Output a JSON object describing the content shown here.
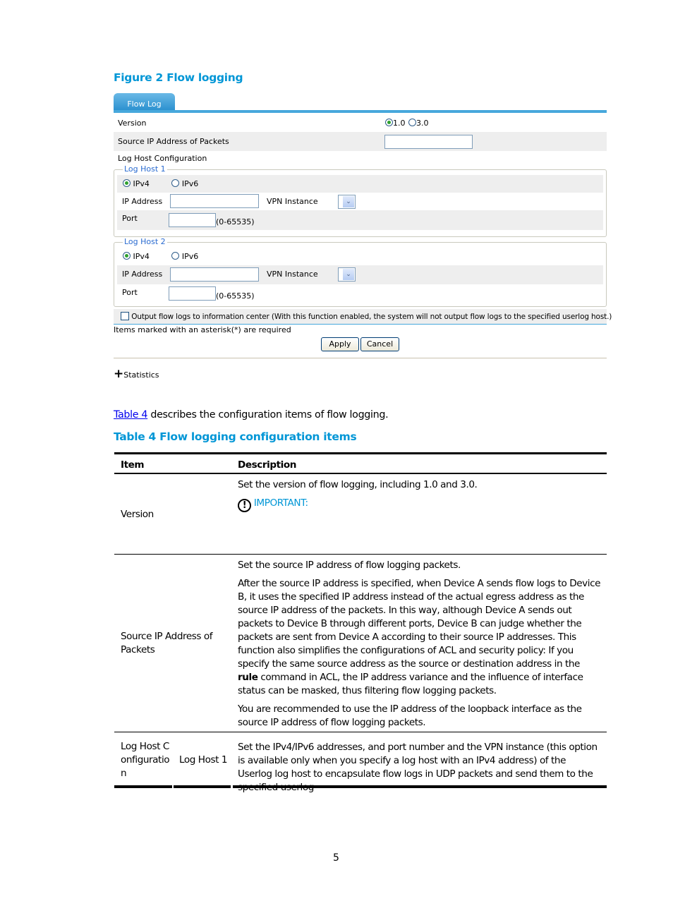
{
  "figure_caption": "Figure 2 Flow logging",
  "ui": {
    "tab_label": "Flow Log",
    "version": {
      "label": "Version",
      "options": [
        {
          "label": "1.0",
          "selected": true
        },
        {
          "label": "3.0",
          "selected": false
        }
      ]
    },
    "source_ip": {
      "label": "Source IP Address of Packets",
      "value": ""
    },
    "log_host_config_label": "Log Host Configuration",
    "log_hosts": [
      {
        "legend": "Log Host 1",
        "ipv4_label": "IPv4",
        "ipv6_label": "IPv6",
        "selected": "IPv4",
        "ip_address_label": "IP Address",
        "ip_address_value": "",
        "vpn_label": "VPN Instance",
        "vpn_value": "",
        "port_label": "Port",
        "port_value": "",
        "port_range": "(0-65535)"
      },
      {
        "legend": "Log Host 2",
        "ipv4_label": "IPv4",
        "ipv6_label": "IPv6",
        "selected": "IPv4",
        "ip_address_label": "IP Address",
        "ip_address_value": "",
        "vpn_label": "VPN Instance",
        "vpn_value": "",
        "port_label": "Port",
        "port_value": "",
        "port_range": "(0-65535)"
      }
    ],
    "output_checkbox": {
      "label": "Output flow logs to information center (With this function enabled, the system will not output flow logs to the specified userlog host.)",
      "checked": false
    },
    "required_note": "Items marked with an asterisk(*) are required",
    "apply_label": "Apply",
    "cancel_label": "Cancel",
    "statistics_label": "Statistics",
    "expand_icon": "plus-icon"
  },
  "intro": {
    "link_text": "Table 4",
    "rest": " describes the configuration items of flow logging."
  },
  "table_caption": "Table 4 Flow logging configuration items",
  "table": {
    "headers": [
      "Item",
      "Description"
    ],
    "rows": [
      {
        "item": "Version",
        "desc": [
          "Set the version of flow logging, including 1.0 and 3.0."
        ],
        "important_label": "IMPORTANT:",
        "important_icon": "exclamation-circle-icon"
      },
      {
        "item": "Source IP Address of Packets",
        "desc": [
          "Set the source IP address of flow logging packets.",
          "After the source IP address is specified, when Device A sends flow logs to Device B, it uses the specified IP address instead of the actual egress address as the source IP address of the packets. In this way, although Device A sends out packets to Device B through different ports, Device B can judge whether the packets are sent from Device A according to their source IP addresses. This function also simplifies the configurations of ACL and security policy: If you specify the same source address as the source or destination address in the ",
          "You are recommended to use the IP address of the loopback interface as the source IP address of flow logging packets."
        ],
        "bold_word": "rule",
        "desc_after_bold": " command in ACL, the IP address variance and the influence of interface status can be masked, thus filtering flow logging packets."
      },
      {
        "item": "Log Host Configuration",
        "subitem": "Log Host 1",
        "desc": [
          "Set the IPv4/IPv6 addresses, and port number and the VPN instance (this option is available only when you specify a log host with an IPv4 address) of the Userlog log host to encapsulate flow logs in UDP packets and send them to the specified userlog"
        ]
      }
    ]
  },
  "page_number": "5"
}
